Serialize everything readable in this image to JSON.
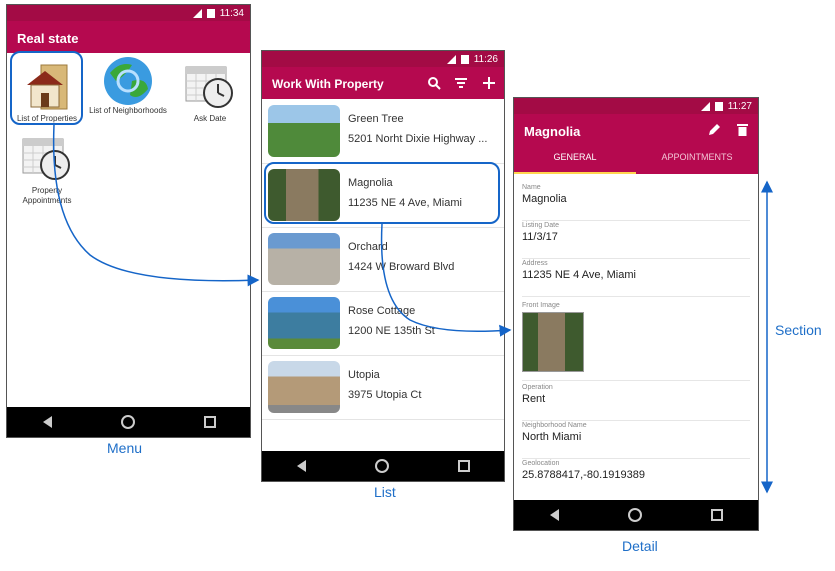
{
  "menu": {
    "time": "11:34",
    "title": "Real state",
    "items": [
      {
        "label": "List of Properties",
        "icon": "folder-house-icon"
      },
      {
        "label": "List of Neighborhoods",
        "icon": "globe-icon"
      },
      {
        "label": "Ask Date",
        "icon": "calendar-clock-icon"
      },
      {
        "label": "Property Appointments",
        "icon": "calendar-clock-icon"
      }
    ],
    "caption": "Menu"
  },
  "list": {
    "time": "11:26",
    "title": "Work With Property",
    "actions": [
      "search-icon",
      "filter-icon",
      "add-icon"
    ],
    "rows": [
      {
        "name": "Green Tree",
        "address": "5201 Norht Dixie Highway ..."
      },
      {
        "name": "Magnolia",
        "address": "11235 NE 4 Ave, Miami"
      },
      {
        "name": "Orchard",
        "address": "1424 W Broward Blvd"
      },
      {
        "name": "Rose Cottage",
        "address": "1200 NE 135th St"
      },
      {
        "name": "Utopia",
        "address": "3975 Utopia Ct"
      }
    ],
    "caption": "List"
  },
  "detail": {
    "time": "11:27",
    "title": "Magnolia",
    "tabs": [
      "GENERAL",
      "APPOINTMENTS"
    ],
    "fields": {
      "name": {
        "label": "Name",
        "value": "Magnolia"
      },
      "listing_date": {
        "label": "Listing Date",
        "value": "11/3/17"
      },
      "address": {
        "label": "Address",
        "value": "11235 NE 4 Ave, Miami"
      },
      "front_image": {
        "label": "Front Image"
      },
      "operation": {
        "label": "Operation",
        "value": "Rent"
      },
      "neighborhood": {
        "label": "Neighborhood Name",
        "value": "North Miami"
      },
      "geolocation": {
        "label": "Geolocation",
        "value": "25.8788417,-80.1919389"
      }
    },
    "caption": "Detail"
  },
  "section_caption": "Section",
  "colors": {
    "primary": "#b5094f",
    "status": "#a30b45",
    "accent": "#ffd54f",
    "annotation": "#1565c8"
  }
}
